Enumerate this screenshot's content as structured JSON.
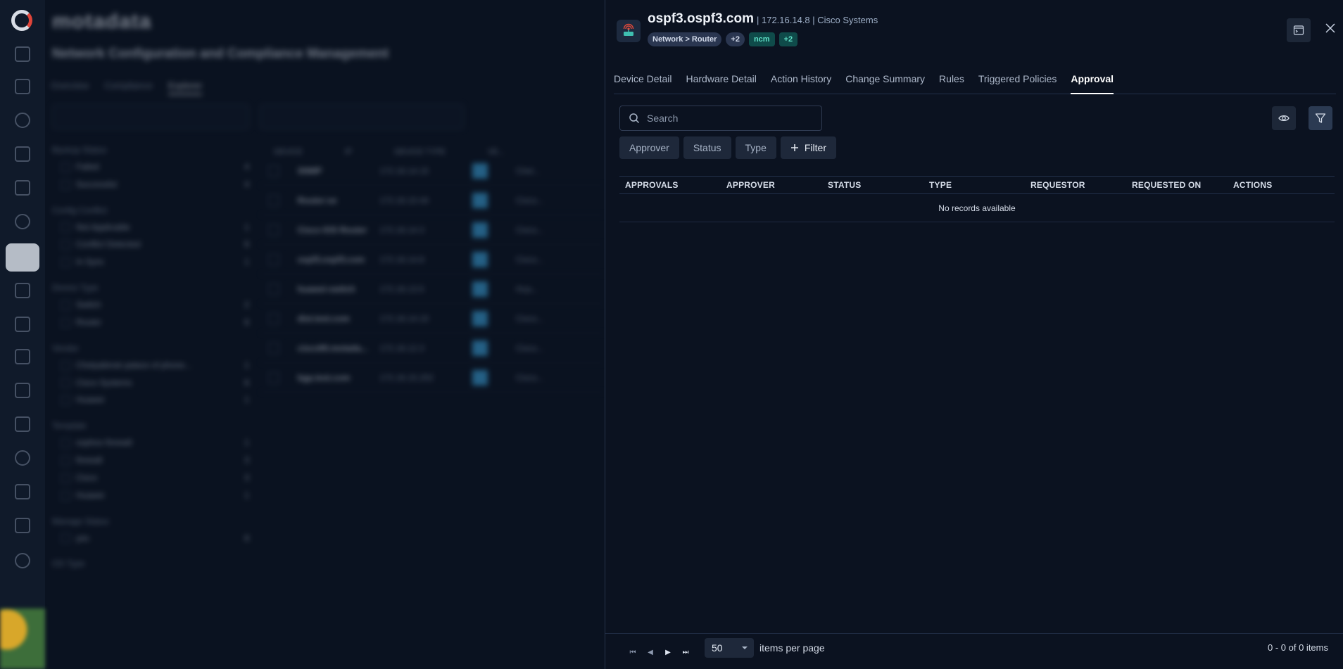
{
  "background_app": {
    "brand": "motadata",
    "title": "Network Configuration and Compliance Management",
    "tabs": [
      "Overview",
      "Compliance",
      "Explorer"
    ],
    "search_placeholder": "Search",
    "filter_groups": [
      {
        "name": "Backup Status",
        "items": [
          {
            "label": "Failed",
            "count": "4"
          },
          {
            "label": "Successful",
            "count": "4"
          }
        ]
      },
      {
        "name": "Config Conflict",
        "items": [
          {
            "label": "Not Applicable",
            "count": "1"
          },
          {
            "label": "Conflict Detected",
            "count": "6"
          },
          {
            "label": "In Sync",
            "count": "1"
          }
        ]
      },
      {
        "name": "Device Type",
        "items": [
          {
            "label": "Switch",
            "count": "2"
          },
          {
            "label": "Router",
            "count": "6"
          }
        ]
      },
      {
        "name": "Vendor",
        "items": [
          {
            "label": "Chelyabinsk palace of phone...",
            "count": "1"
          },
          {
            "label": "Cisco Systems",
            "count": "6"
          },
          {
            "label": "Huawei",
            "count": "1"
          }
        ]
      },
      {
        "name": "Template",
        "items": [
          {
            "label": "sophos firewall",
            "count": "1"
          },
          {
            "label": "firewall",
            "count": "3"
          },
          {
            "label": "Cisco",
            "count": "3"
          },
          {
            "label": "Huawei",
            "count": "1"
          }
        ]
      },
      {
        "name": "Manage Status",
        "items": [
          {
            "label": "yes",
            "count": "8"
          }
        ]
      },
      {
        "name": "OS Type",
        "items": []
      }
    ],
    "grid_headers": [
      "DEVICE",
      "IP",
      "DEVICE TYPE",
      "VE..."
    ],
    "grid_rows": [
      {
        "device": "SNMP",
        "ip": "172.16.14.15",
        "vendor": "Chel..."
      },
      {
        "device": "Router-xe",
        "ip": "172.16.10.44",
        "vendor": "Cisco..."
      },
      {
        "device": "Cisco IOS Router",
        "ip": "172.16.14.3",
        "vendor": "Cisco..."
      },
      {
        "device": "ospf3.ospf3.com",
        "ip": "172.16.14.8",
        "vendor": "Cisco..."
      },
      {
        "device": "huawei-switch",
        "ip": "172.16.13.5",
        "vendor": "Hua..."
      },
      {
        "device": "dist.test.com",
        "ip": "172.16.14.10",
        "vendor": "Cisco..."
      },
      {
        "device": "cisco90.motada...",
        "ip": "172.16.12.3",
        "vendor": "Cisco..."
      },
      {
        "device": "bgp.test.com",
        "ip": "172.16.15.202",
        "vendor": "Cisco..."
      }
    ],
    "pager_label": "items per page",
    "pager_size": "50"
  },
  "device": {
    "name": "ospf3.ospf3.com",
    "meta": "| 172.16.14.8 | Cisco Systems",
    "type_chip": "Network > Router",
    "type_more": "+2",
    "tag": "ncm",
    "tag_more": "+2",
    "icon": "router-icon"
  },
  "tabs": [
    {
      "label": "Device Detail",
      "active": false
    },
    {
      "label": "Hardware Detail",
      "active": false
    },
    {
      "label": "Action History",
      "active": false
    },
    {
      "label": "Change Summary",
      "active": false
    },
    {
      "label": "Rules",
      "active": false
    },
    {
      "label": "Triggered Policies",
      "active": false
    },
    {
      "label": "Approval",
      "active": true
    }
  ],
  "search": {
    "placeholder": "Search"
  },
  "quick_filters": [
    "Approver",
    "Status",
    "Type"
  ],
  "add_filter_label": "Filter",
  "table": {
    "columns": [
      "APPROVALS",
      "APPROVER",
      "STATUS",
      "TYPE",
      "REQUESTOR",
      "REQUESTED ON",
      "ACTIONS"
    ],
    "empty_text": "No records available"
  },
  "pagination": {
    "page_size": "50",
    "page_size_label": "items per page",
    "count_text": "0 - 0 of 0 items"
  },
  "colors": {
    "background": "#0a1220",
    "drawer": "#0b1220",
    "accent_tag": "#5fe0c7",
    "active_tab": "#ffffff"
  }
}
